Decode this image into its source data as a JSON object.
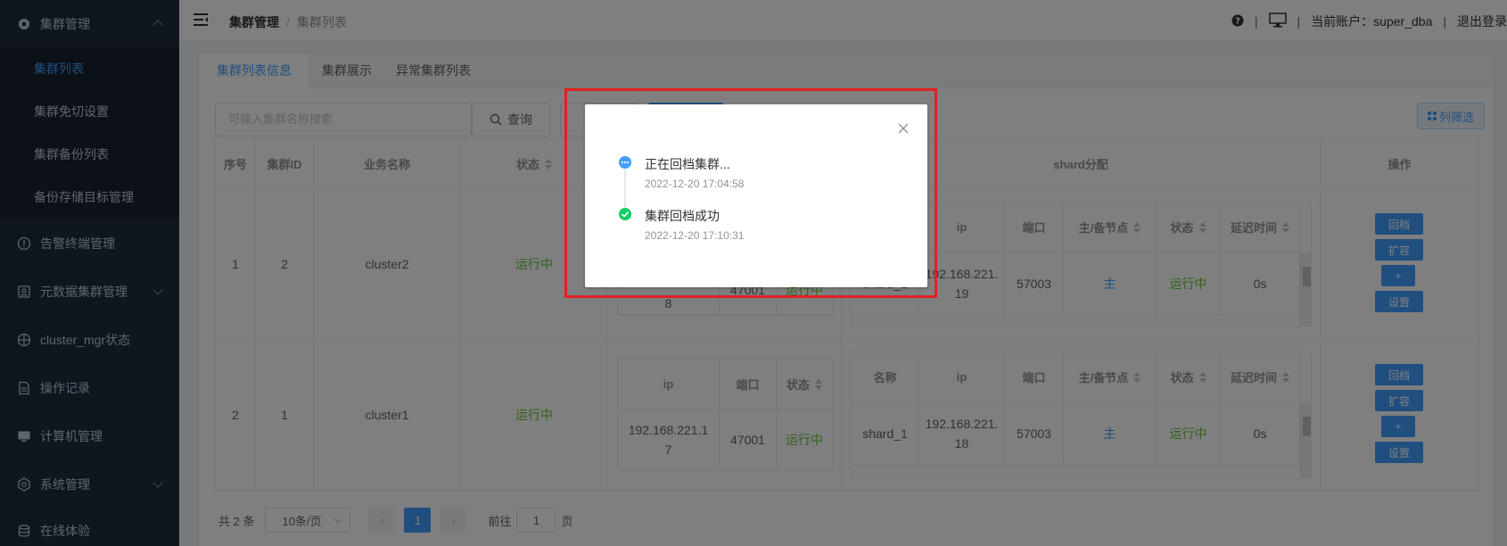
{
  "sidebar": {
    "groups": [
      {
        "label": "集群管理",
        "icon": "gear-icon",
        "expanded": true
      },
      {
        "label": "告警终端管理",
        "icon": "info-icon"
      },
      {
        "label": "元数据集群管理",
        "icon": "database-icon"
      },
      {
        "label": "cluster_mgr状态",
        "icon": "status-icon"
      },
      {
        "label": "操作记录",
        "icon": "document-icon"
      },
      {
        "label": "计算机管理",
        "icon": "monitor-icon"
      },
      {
        "label": "系统管理",
        "icon": "settings-icon"
      },
      {
        "label": "在线体验",
        "icon": "stack-icon"
      }
    ],
    "sub_items": [
      "集群列表",
      "集群免切设置",
      "集群备份列表",
      "备份存储目标管理"
    ]
  },
  "header": {
    "breadcrumb_1": "集群管理",
    "breadcrumb_sep": "/",
    "breadcrumb_2": "集群列表",
    "account": "当前账户：super_dba",
    "logout": "退出登录",
    "sep": "|"
  },
  "tabs": [
    "集群列表信息",
    "集群展示",
    "异常集群列表"
  ],
  "toolbar": {
    "search_placeholder": "可输入集群名称搜索",
    "query_label": "查询",
    "column_filter": "列筛选"
  },
  "table": {
    "headers": {
      "index": "序号",
      "cluster_id": "集群ID",
      "biz_name": "业务名称",
      "status": "状态",
      "shard": "shard分配",
      "op": "操作"
    },
    "comp_headers": {
      "ip": "ip",
      "port": "端口",
      "status": "状态"
    },
    "shard_headers": {
      "name": "名称",
      "ip": "ip",
      "port": "端口",
      "role": "主/备节点",
      "status": "状态",
      "delay": "延迟时间"
    },
    "rows": [
      {
        "index": "1",
        "cluster_id": "2",
        "biz_name": "cluster2",
        "status": "运行中",
        "comp_ip_tail": "8",
        "comp_port": "47001",
        "comp_status": "运行中",
        "shard_name": "shard_1",
        "shard_ip": "192.168.221.19",
        "shard_ip_l1": "192.168.221.",
        "shard_ip_l2": "19",
        "shard_port": "57003",
        "shard_role": "主",
        "shard_status": "运行中",
        "shard_delay": "0s"
      },
      {
        "index": "2",
        "cluster_id": "1",
        "biz_name": "cluster1",
        "status": "运行中",
        "comp_ip_l1": "192.168.221.1",
        "comp_ip_l2": "7",
        "comp_port": "47001",
        "comp_status": "运行中",
        "shard_name": "shard_1",
        "shard_ip_l1": "192.168.221.",
        "shard_ip_l2": "18",
        "shard_port": "57003",
        "shard_role": "主",
        "shard_status": "运行中",
        "shard_delay": "0s"
      }
    ],
    "ops": [
      "回档",
      "扩容",
      "+",
      "设置"
    ]
  },
  "pagination": {
    "total": "共 2 条",
    "page_size": "10条/页",
    "current": "1",
    "goto_prefix": "前往",
    "goto_value": "1",
    "goto_suffix": "页"
  },
  "dialog": {
    "steps": [
      {
        "title": "正在回档集群...",
        "time": "2022-12-20 17:04:58",
        "state": "in-progress",
        "color": "#409eff"
      },
      {
        "title": "集群回档成功",
        "time": "2022-12-20 17:10:31",
        "state": "done",
        "color": "#13ce66"
      }
    ]
  },
  "colors": {
    "accent": "#409eff",
    "success": "#67c23a",
    "sidebar": "#1f2d3d",
    "highlight": "#e32020"
  }
}
